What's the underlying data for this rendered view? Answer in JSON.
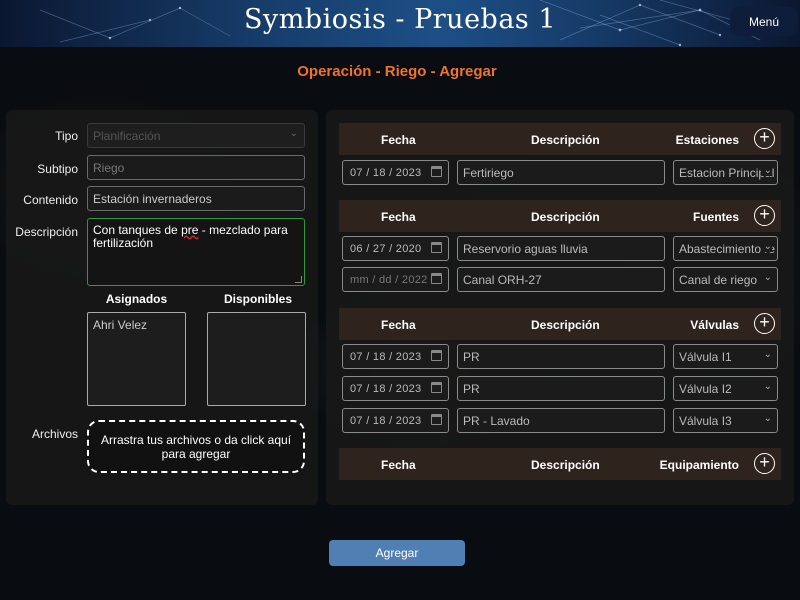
{
  "app": {
    "title": "Symbiosis - Pruebas 1",
    "menu_label": "Menú"
  },
  "page": {
    "heading": "Operación - Riego - Agregar"
  },
  "form": {
    "tipo": {
      "label": "Tipo",
      "value": "Planificación"
    },
    "subtipo": {
      "label": "Subtipo",
      "placeholder": "Riego"
    },
    "contenido": {
      "label": "Contenido",
      "value": "Estación invernaderos"
    },
    "descripcion": {
      "label": "Descripción",
      "value_before": "Con tanques de ",
      "value_misspelled": "pre",
      "value_after": " - mezclado para fertilización"
    },
    "asignados": {
      "label": "Asignados",
      "items": [
        "Ahri Velez"
      ]
    },
    "disponibles": {
      "label": "Disponibles",
      "items": []
    },
    "archivos": {
      "label": "Archivos",
      "dropzone_text": "Arrastra tus archivos o da click aquí para agregar"
    }
  },
  "sections": {
    "estaciones": {
      "headers": {
        "fecha": "Fecha",
        "descripcion": "Descripción",
        "right": "Estaciones"
      },
      "rows": [
        {
          "date": "07 / 18 / 2023",
          "description": "Fertiriego",
          "select": "Estacion Principal"
        }
      ]
    },
    "fuentes": {
      "headers": {
        "fecha": "Fecha",
        "descripcion": "Descripción",
        "right": "Fuentes"
      },
      "rows": [
        {
          "date": "06 / 27 / 2020",
          "description": "Reservorio aguas lluvia",
          "select": "Abastecimiento re"
        },
        {
          "date": "mm / dd / 2022",
          "description": "Canal ORH-27",
          "select": "Canal de riego"
        }
      ]
    },
    "valvulas": {
      "headers": {
        "fecha": "Fecha",
        "descripcion": "Descripción",
        "right": "Válvulas"
      },
      "rows": [
        {
          "date": "07 / 18 / 2023",
          "description": "PR",
          "select": "Válvula I1"
        },
        {
          "date": "07 / 18 / 2023",
          "description": "PR",
          "select": "Válvula I2"
        },
        {
          "date": "07 / 18 / 2023",
          "description": "PR - Lavado",
          "select": "Válvula I3"
        }
      ]
    },
    "equipamiento": {
      "headers": {
        "fecha": "Fecha",
        "descripcion": "Descripción",
        "right": "Equipamiento"
      },
      "rows": []
    }
  },
  "actions": {
    "submit_label": "Agregar"
  },
  "colors": {
    "accent": "#f2722b",
    "submit": "#4f7fb3",
    "section_header": "#2e241d",
    "focus_border": "#2f9a3c"
  },
  "icons": {
    "add": "plus-circle-icon",
    "calendar": "calendar-icon",
    "dropdown": "chevron-down-icon"
  }
}
